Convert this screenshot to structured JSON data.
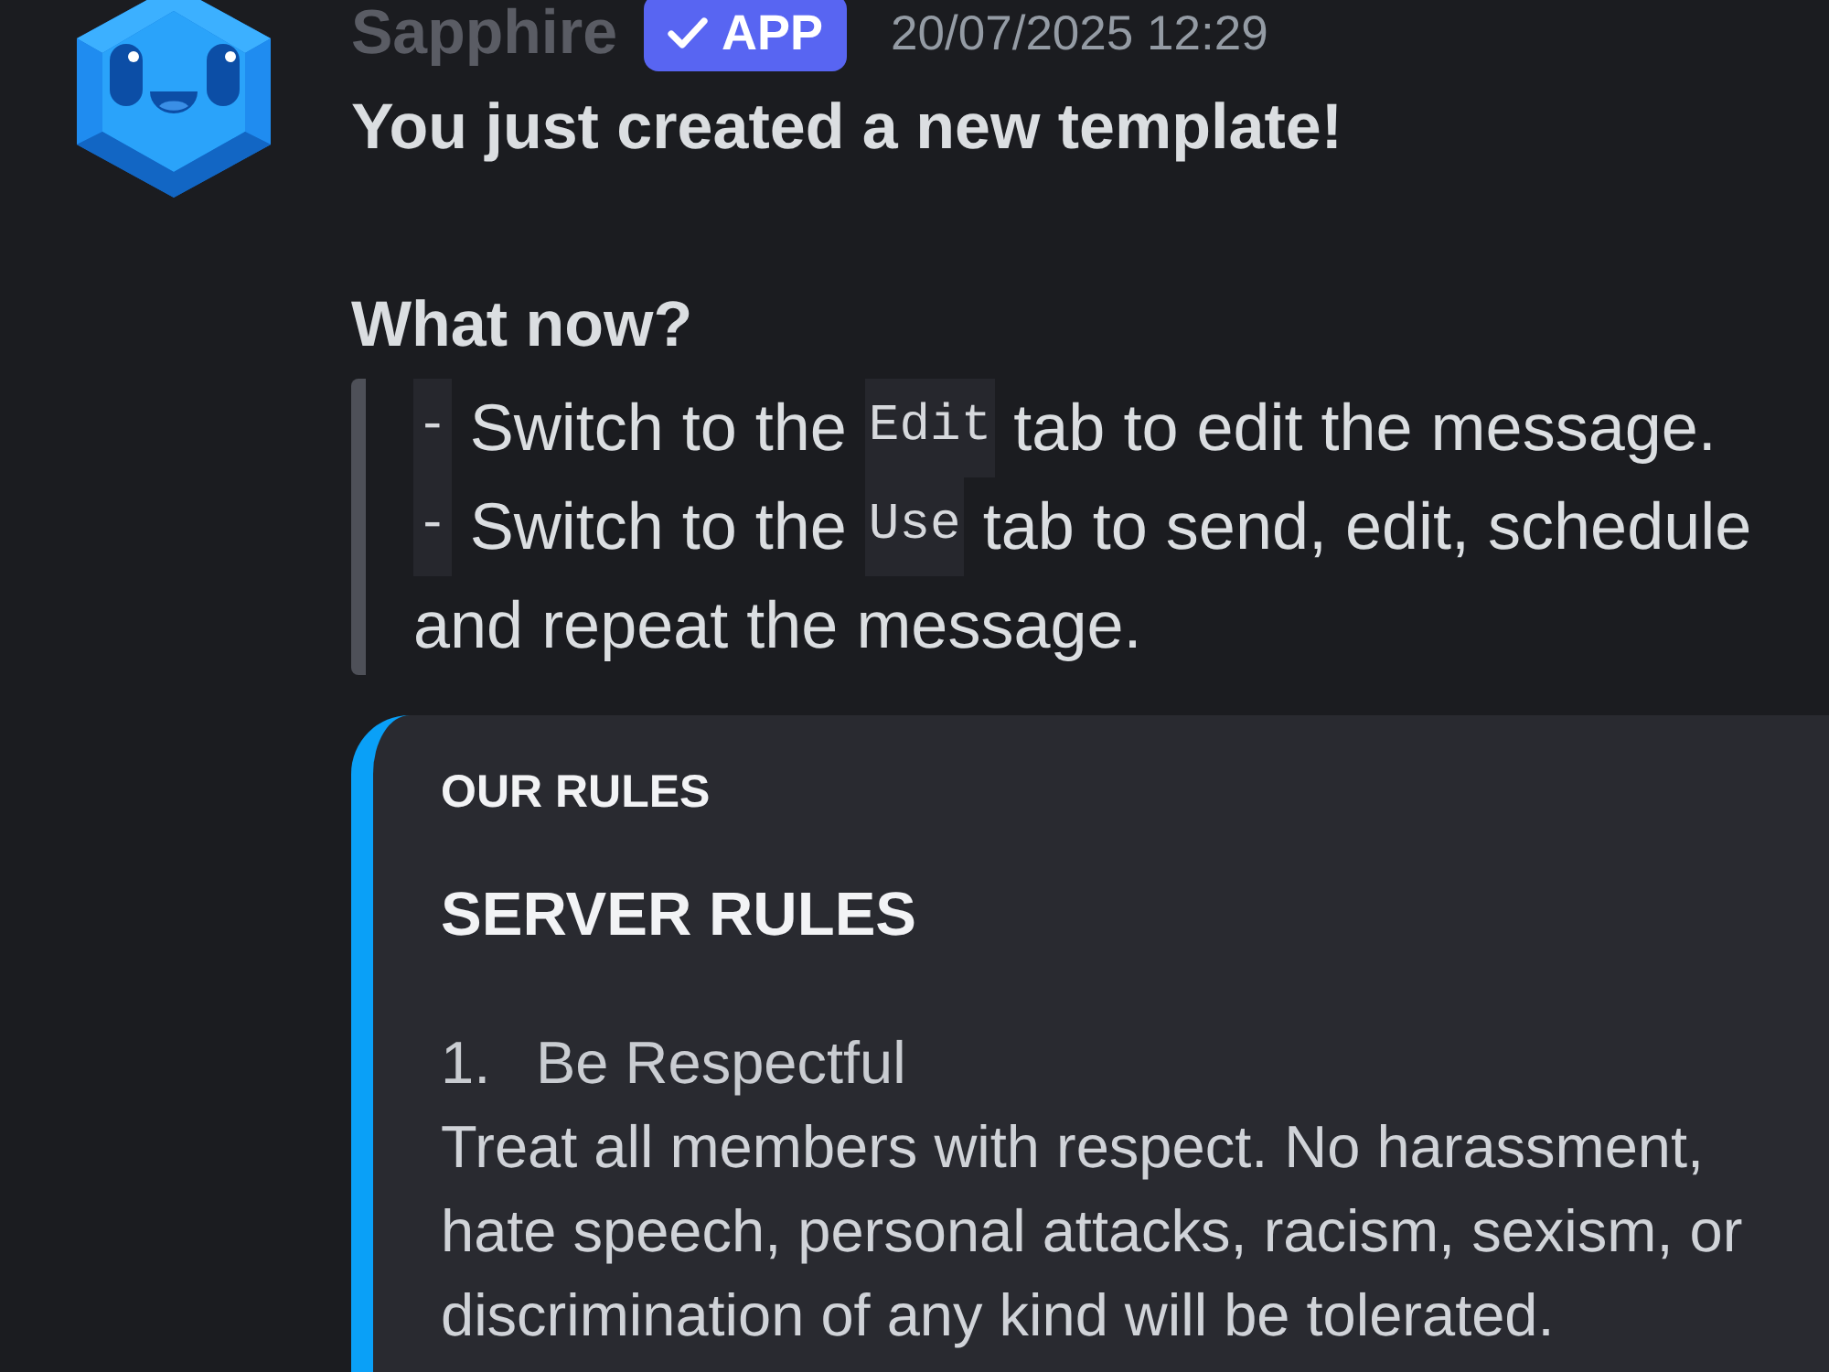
{
  "message": {
    "author": "Sapphire",
    "badge": {
      "label": "APP",
      "verified": true
    },
    "timestamp": "20/07/2025 12:29",
    "content": [
      {
        "kind": "title",
        "text": "You just created a new template!"
      },
      {
        "kind": "subtitle",
        "text": "What now?"
      },
      {
        "kind": "quote",
        "lines": [
          [
            {
              "kind": "code",
              "text": "-"
            },
            {
              "kind": "text",
              "text": " Switch to the "
            },
            {
              "kind": "code",
              "text": "Edit"
            },
            {
              "kind": "text",
              "text": " tab to edit the message."
            }
          ],
          [
            {
              "kind": "code",
              "text": "-"
            },
            {
              "kind": "text",
              "text": " Switch to the "
            },
            {
              "kind": "code",
              "text": "Use"
            },
            {
              "kind": "text",
              "text": " tab to send, edit, schedule and repeat the message."
            }
          ]
        ]
      }
    ],
    "embed": {
      "author": "OUR RULES",
      "title": "SERVER RULES",
      "description": [
        {
          "kind": "list_item",
          "number": "1.",
          "text": "Be Respectful"
        },
        {
          "kind": "paragraph",
          "text": "Treat all members with respect. No harassment, hate speech, personal attacks, racism, sexism, or discrimination of any kind will be tolerated."
        }
      ]
    }
  }
}
